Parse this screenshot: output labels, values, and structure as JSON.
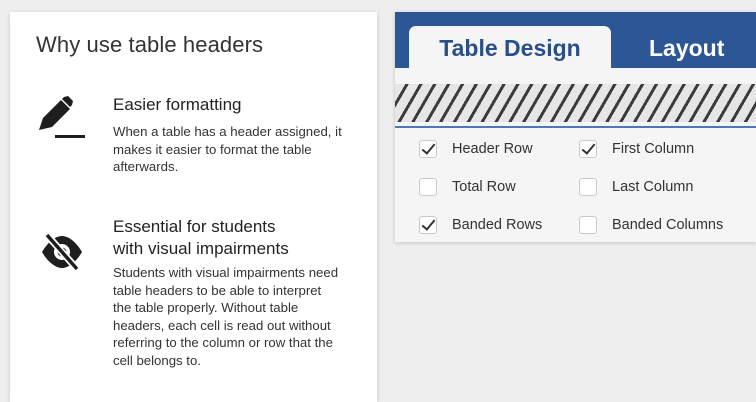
{
  "info_card": {
    "title": "Why use table headers",
    "features": [
      {
        "icon": "pencil-edit-icon",
        "heading_lines": [
          "Easier formatting"
        ],
        "body": "When a table has a header assigned, it makes it easier to format the table afterwards."
      },
      {
        "icon": "eye-slash-icon",
        "heading_lines": [
          "Essential for students",
          "with visual impairments"
        ],
        "body": "Students with visual impairments need table headers to be able to interpret the table properly. Without table headers, each cell is read out without referring to the column or row that the cell belongs to."
      }
    ]
  },
  "ribbon": {
    "tabs": [
      {
        "label": "Table Design",
        "active": true
      },
      {
        "label": "Layout",
        "active": false
      }
    ],
    "accent_color": "#2c5694",
    "options": [
      {
        "label": "Header Row",
        "checked": true
      },
      {
        "label": "First Column",
        "checked": true
      },
      {
        "label": "Total Row",
        "checked": false
      },
      {
        "label": "Last Column",
        "checked": false
      },
      {
        "label": "Banded Rows",
        "checked": true
      },
      {
        "label": "Banded Columns",
        "checked": false
      }
    ]
  }
}
